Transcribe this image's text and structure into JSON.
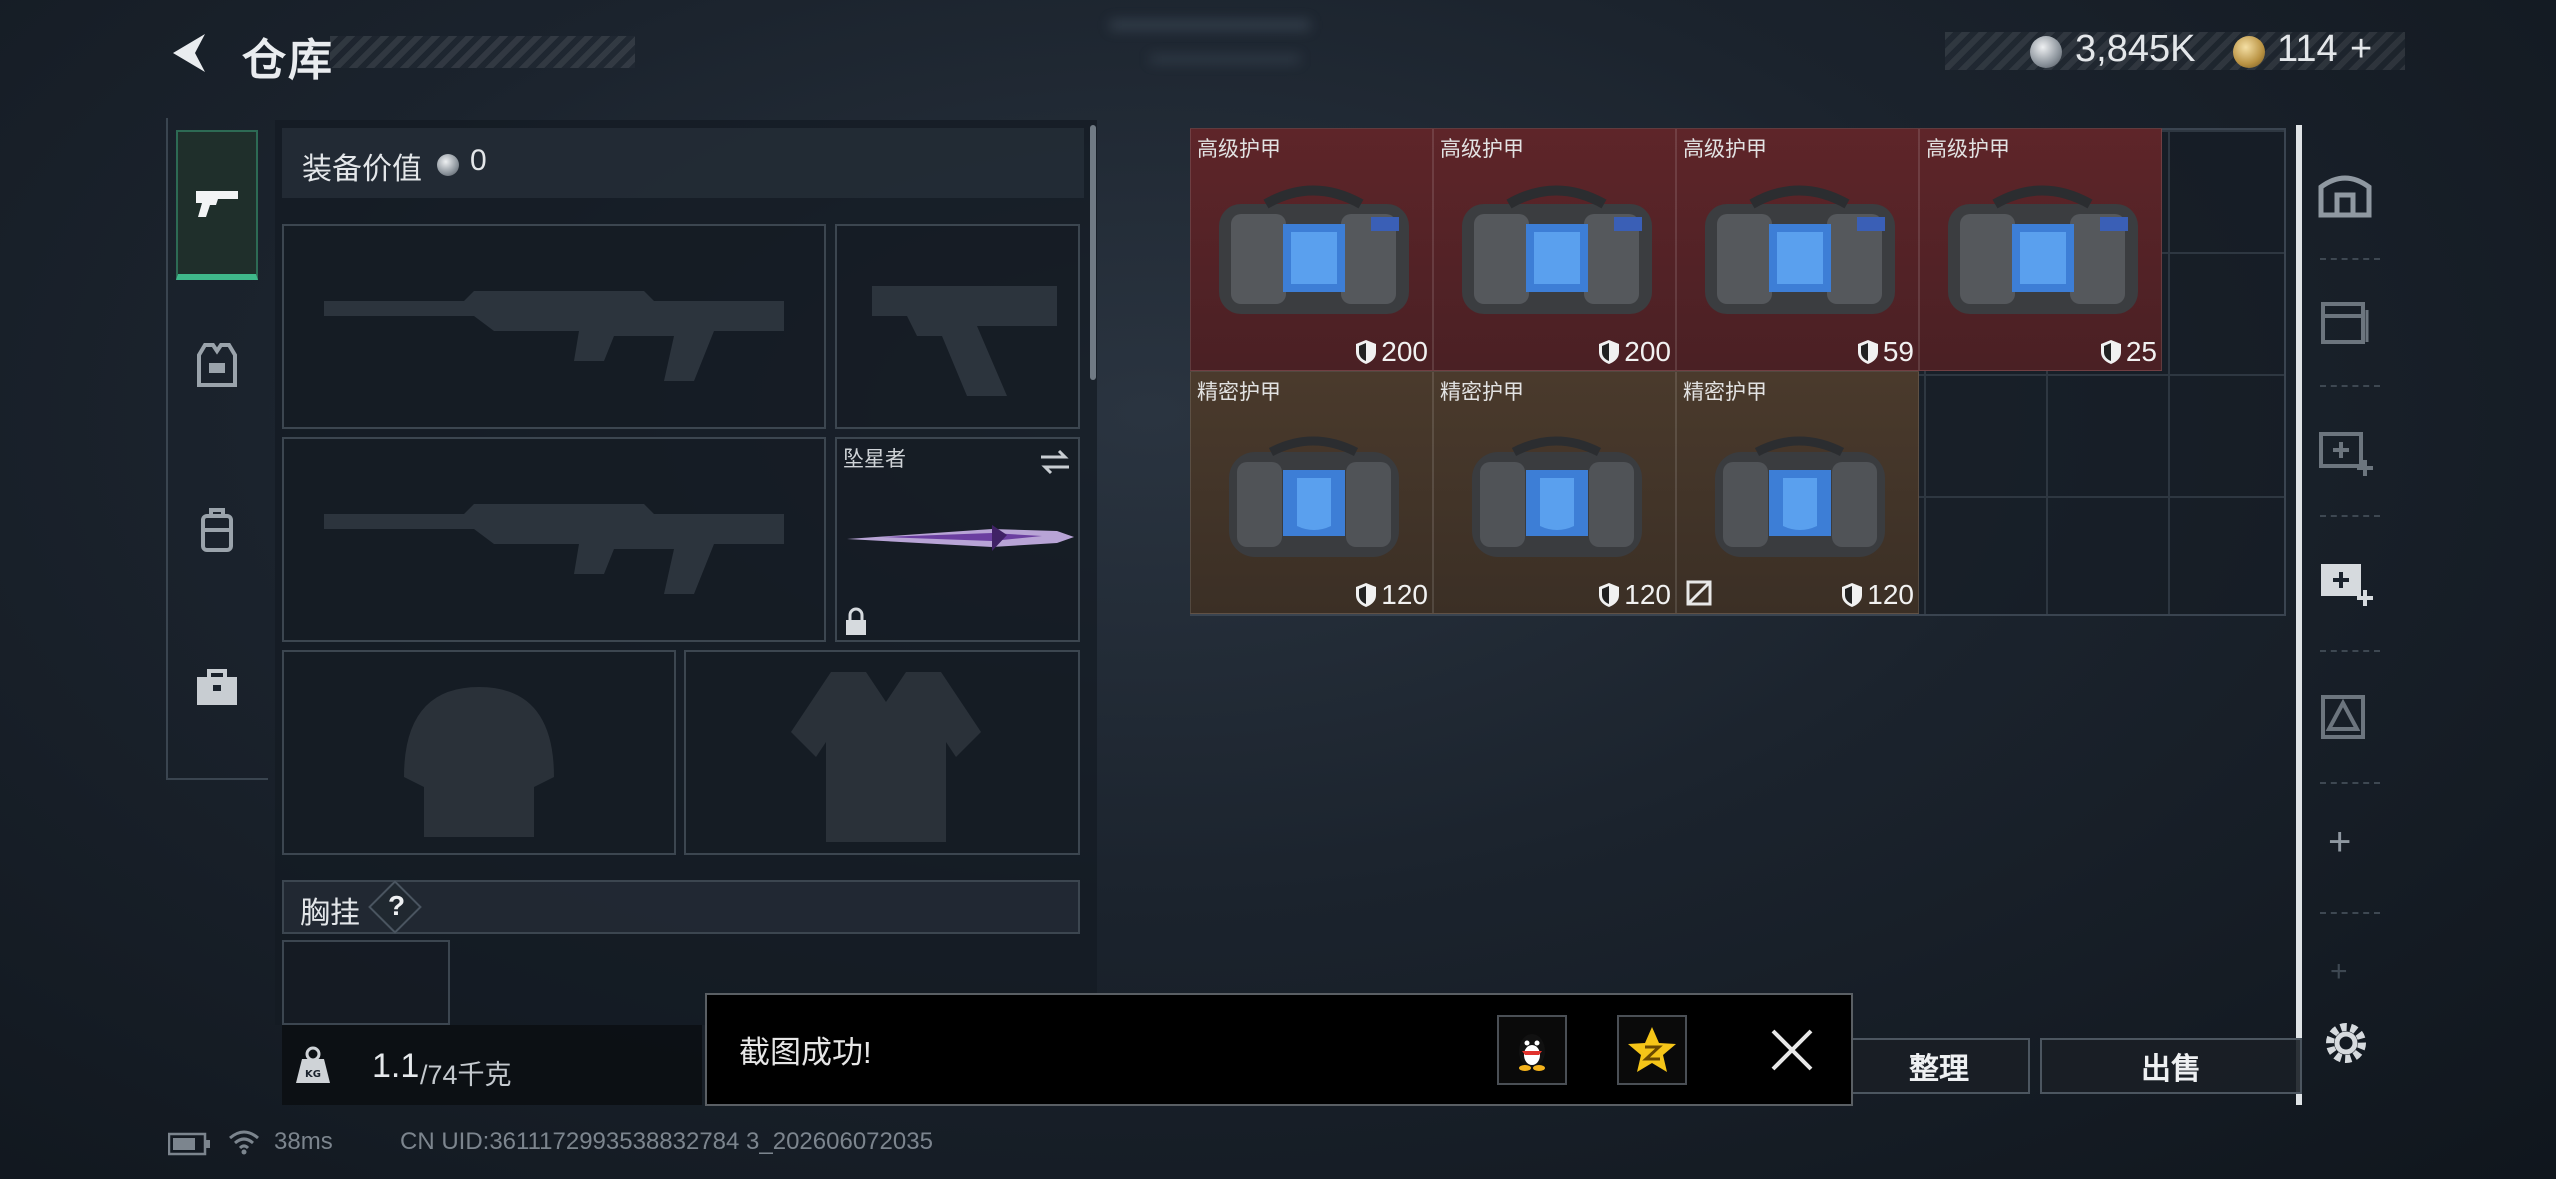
{
  "header": {
    "title": "仓库",
    "currency_silver": "3,845K",
    "currency_gold": "114",
    "gold_plus": "+"
  },
  "left_tabs": [
    {
      "name": "weapons",
      "icon": "pistol-icon",
      "active": true
    },
    {
      "name": "armor",
      "icon": "vest-icon",
      "active": false
    },
    {
      "name": "backpack",
      "icon": "backpack-icon",
      "active": false
    },
    {
      "name": "toolbox",
      "icon": "briefcase-icon",
      "active": false
    }
  ],
  "equipment": {
    "value_label": "装备价值",
    "value": "0",
    "melee_name": "坠星者",
    "chest_rig_label": "胸挂",
    "help_symbol": "?"
  },
  "inventory": {
    "items": [
      {
        "name": "高级护甲",
        "value": "200",
        "rarity": "red",
        "broken": false
      },
      {
        "name": "高级护甲",
        "value": "200",
        "rarity": "red",
        "broken": false
      },
      {
        "name": "高级护甲",
        "value": "59",
        "rarity": "red",
        "broken": false
      },
      {
        "name": "高级护甲",
        "value": "25",
        "rarity": "red",
        "broken": false
      },
      {
        "name": "精密护甲",
        "value": "120",
        "rarity": "brown",
        "broken": false
      },
      {
        "name": "精密护甲",
        "value": "120",
        "rarity": "brown",
        "broken": false
      },
      {
        "name": "精密护甲",
        "value": "120",
        "rarity": "brown",
        "broken": true
      }
    ]
  },
  "right_tools": [
    {
      "icon": "safe-box-icon"
    },
    {
      "icon": "storage-box-icon"
    },
    {
      "icon": "add-storage-icon"
    },
    {
      "icon": "add-storage-active-icon"
    },
    {
      "icon": "pyramid-crate-icon"
    },
    {
      "icon": "plus-icon",
      "symbol": "+"
    },
    {
      "icon": "plus-faint-icon",
      "symbol": "+"
    }
  ],
  "bottom": {
    "weight_current": "1.1",
    "weight_max": "/74千克",
    "sort_label": "整理",
    "sell_label": "出售"
  },
  "toast": {
    "message": "截图成功!"
  },
  "status_bar": {
    "ping": "38ms",
    "uid": "CN UID:3611172993538832784 3_202606072035"
  },
  "colors": {
    "accent_green": "#3fb88a",
    "rarity_red": "#5e2529",
    "rarity_brown": "#4a3a2c"
  }
}
